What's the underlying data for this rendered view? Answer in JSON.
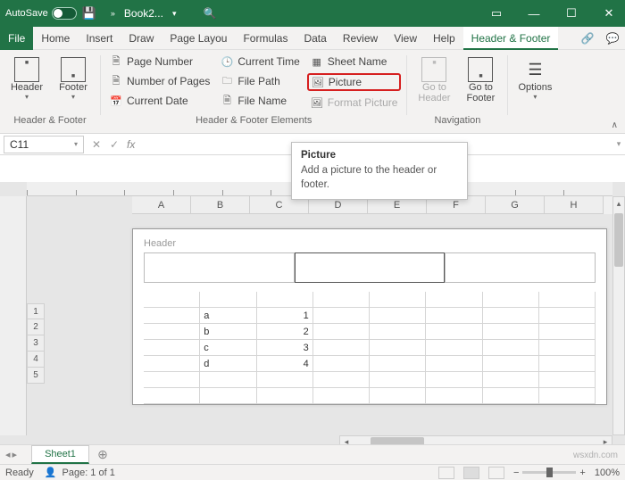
{
  "titlebar": {
    "autosave": "AutoSave",
    "filename": "Book2..."
  },
  "tabs": {
    "file": "File",
    "home": "Home",
    "insert": "Insert",
    "draw": "Draw",
    "pageLayout": "Page Layou",
    "formulas": "Formulas",
    "data": "Data",
    "review": "Review",
    "view": "View",
    "help": "Help",
    "headerFooter": "Header & Footer"
  },
  "ribbon": {
    "group1_label": "Header & Footer",
    "group2_label": "Header & Footer Elements",
    "group3_label": "Navigation",
    "header": "Header",
    "footer": "Footer",
    "pageNumber": "Page Number",
    "numberOfPages": "Number of Pages",
    "currentDate": "Current Date",
    "currentTime": "Current Time",
    "filePath": "File Path",
    "fileName": "File Name",
    "sheetName": "Sheet Name",
    "picture": "Picture",
    "formatPicture": "Format Picture",
    "gotoHeader": "Go to Header",
    "gotoFooter": "Go to Footer",
    "options": "Options"
  },
  "namebox": "C11",
  "fx": "fx",
  "tooltip": {
    "title": "Picture",
    "body": "Add a picture to the header or footer."
  },
  "cols": [
    "A",
    "B",
    "C",
    "D",
    "E",
    "F",
    "G",
    "H"
  ],
  "rows": [
    "1",
    "2",
    "3",
    "4",
    "5"
  ],
  "headerLabel": "Header",
  "data_rows": [
    {
      "b": "a",
      "c": "1"
    },
    {
      "b": "b",
      "c": "2"
    },
    {
      "b": "c",
      "c": "3"
    },
    {
      "b": "d",
      "c": "4"
    }
  ],
  "sheettab": "Sheet1",
  "status": {
    "ready": "Ready",
    "page": "Page: 1 of 1",
    "zoom": "100%"
  },
  "watermark": "wsxdn.com"
}
